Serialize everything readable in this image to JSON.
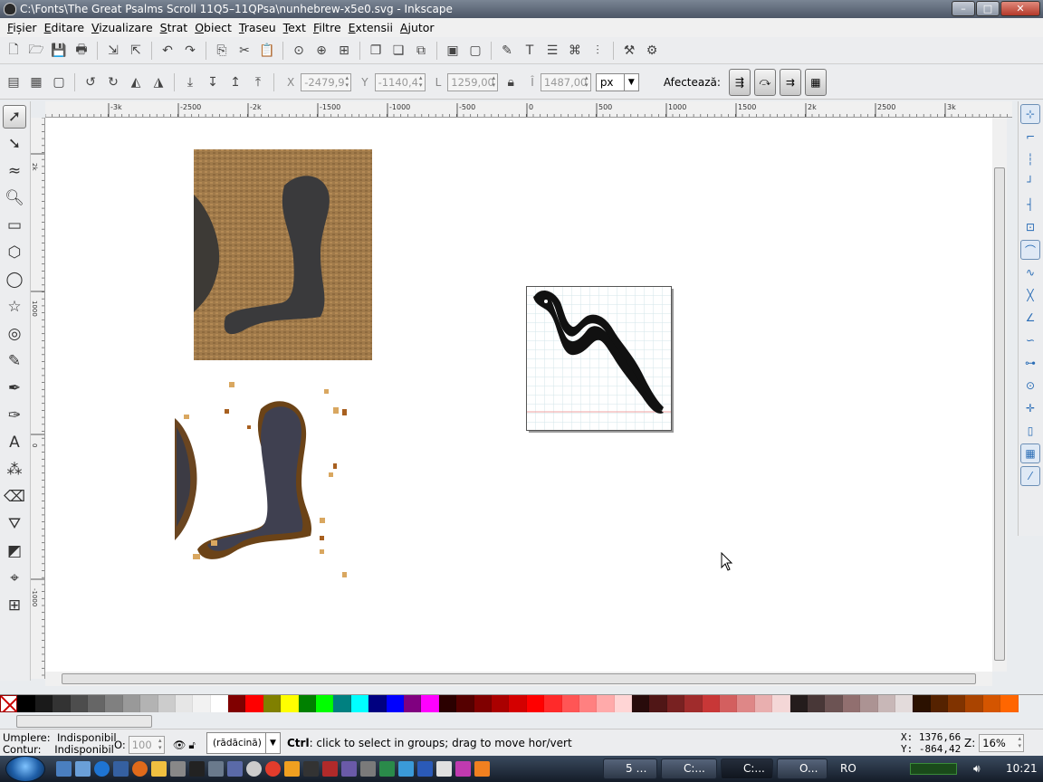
{
  "window": {
    "title": "C:\\Fonts\\The Great Psalms Scroll 11Q5–11QPsa\\nunhebrew-x5e0.svg - Inkscape",
    "minimize": "–",
    "maximize": "□",
    "close": "✕"
  },
  "menu": [
    {
      "first": "F",
      "rest": "ișier"
    },
    {
      "first": "E",
      "rest": "ditare"
    },
    {
      "first": "V",
      "rest": "izualizare"
    },
    {
      "first": "S",
      "rest": "trat"
    },
    {
      "first": "O",
      "rest": "biect"
    },
    {
      "first": "T",
      "rest": "raseu"
    },
    {
      "first": "T",
      "rest": "ext"
    },
    {
      "first": "F",
      "rest": "iltre"
    },
    {
      "first": "E",
      "rest": "xtensii"
    },
    {
      "first": "A",
      "rest": "jutor"
    }
  ],
  "toolbar_icons": [
    "new-icon",
    "open-icon",
    "save-icon",
    "print-icon",
    "import-icon",
    "export-icon",
    "undo-icon",
    "redo-icon",
    "copy-icon",
    "cut-icon",
    "paste-icon",
    "zoom-selection-icon",
    "zoom-drawing-icon",
    "zoom-page-icon",
    "duplicate-icon",
    "clone-icon",
    "unlink-clone-icon",
    "group-icon",
    "ungroup-icon",
    "fill-stroke-icon",
    "text-font-icon",
    "layers-icon",
    "xml-editor-icon",
    "align-icon",
    "preferences-icon",
    "document-properties-icon"
  ],
  "select_toolbar": {
    "x_label": "X",
    "x_value": "-2479,9",
    "y_label": "Y",
    "y_value": "-1140,4",
    "w_label": "L",
    "w_value": "1259,00",
    "h_label": "Î",
    "h_value": "1487,00",
    "unit": "px",
    "affect_label": "Afectează:"
  },
  "ruler_h_labels": [
    "-3k",
    "-2500",
    "-2k",
    "-1500",
    "-1000",
    "-500",
    "0",
    "500",
    "1000",
    "1500",
    "2k",
    "2500",
    "3k"
  ],
  "ruler_v_labels": [
    "2k",
    "1000",
    "0",
    "-1000"
  ],
  "tools": [
    "selector-tool-icon",
    "node-tool-icon",
    "tweak-tool-icon",
    "zoom-tool-icon",
    "rectangle-tool-icon",
    "3d-box-tool-icon",
    "ellipse-tool-icon",
    "star-tool-icon",
    "spiral-tool-icon",
    "pencil-tool-icon",
    "pen-tool-icon",
    "calligraphy-tool-icon",
    "text-tool-icon",
    "spray-tool-icon",
    "eraser-tool-icon",
    "paint-bucket-tool-icon",
    "gradient-tool-icon",
    "dropper-tool-icon",
    "connector-tool-icon"
  ],
  "snap_controls": [
    "snap-toggle-icon",
    "snap-bbox-icon",
    "snap-bbox-edge-icon",
    "snap-bbox-corner-icon",
    "snap-bbox-midpoint-icon",
    "snap-bbox-center-icon",
    "snap-nodes-icon",
    "snap-paths-icon",
    "snap-intersections-icon",
    "snap-cusp-icon",
    "snap-smooth-icon",
    "snap-midpoint-icon",
    "snap-center-icon",
    "snap-rotation-center-icon",
    "snap-page-icon",
    "snap-grid-icon",
    "snap-guide-icon"
  ],
  "palette": {
    "colors": [
      "#000000",
      "#1a1a1a",
      "#333333",
      "#4d4d4d",
      "#666666",
      "#808080",
      "#999999",
      "#b3b3b3",
      "#cccccc",
      "#e6e6e6",
      "#f2f2f2",
      "#ffffff",
      "#800000",
      "#ff0000",
      "#808000",
      "#ffff00",
      "#008000",
      "#00ff00",
      "#008080",
      "#00ffff",
      "#000080",
      "#0000ff",
      "#800080",
      "#ff00ff",
      "#2b0000",
      "#550000",
      "#800000",
      "#aa0000",
      "#d40000",
      "#ff0000",
      "#ff2a2a",
      "#ff5555",
      "#ff8080",
      "#ffaaaa",
      "#ffd5d5",
      "#280b0b",
      "#501616",
      "#782121",
      "#a02c2c",
      "#c83737",
      "#d35f5f",
      "#de8787",
      "#e9afaf",
      "#f4d7d7",
      "#241c1c",
      "#483737",
      "#6c5353",
      "#916f6f",
      "#ac9393",
      "#c8b7b7",
      "#e3dbdb",
      "#2b1100",
      "#552200",
      "#803300",
      "#aa4400",
      "#d45500",
      "#ff6600"
    ]
  },
  "status": {
    "fill_label": "Umplere:",
    "fill_value": "Indisponibil",
    "stroke_label": "Contur:",
    "stroke_value": "Indisponibil",
    "opacity_label": "O:",
    "opacity_value": "100",
    "layer": "(rădăcină)",
    "message_key": "Ctrl",
    "message": ": click to select in groups; drag to move hor/vert",
    "x_coord": "X: 1376,66",
    "y_coord": "Y: -864,42",
    "zoom_label": "Z:",
    "zoom_value": "16%"
  },
  "taskbar": {
    "tasks": [
      {
        "label": "5 …"
      },
      {
        "label": "C:..."
      },
      {
        "label": "C:..."
      },
      {
        "label": "O..."
      }
    ],
    "lang": "RO",
    "time": "10:21"
  }
}
